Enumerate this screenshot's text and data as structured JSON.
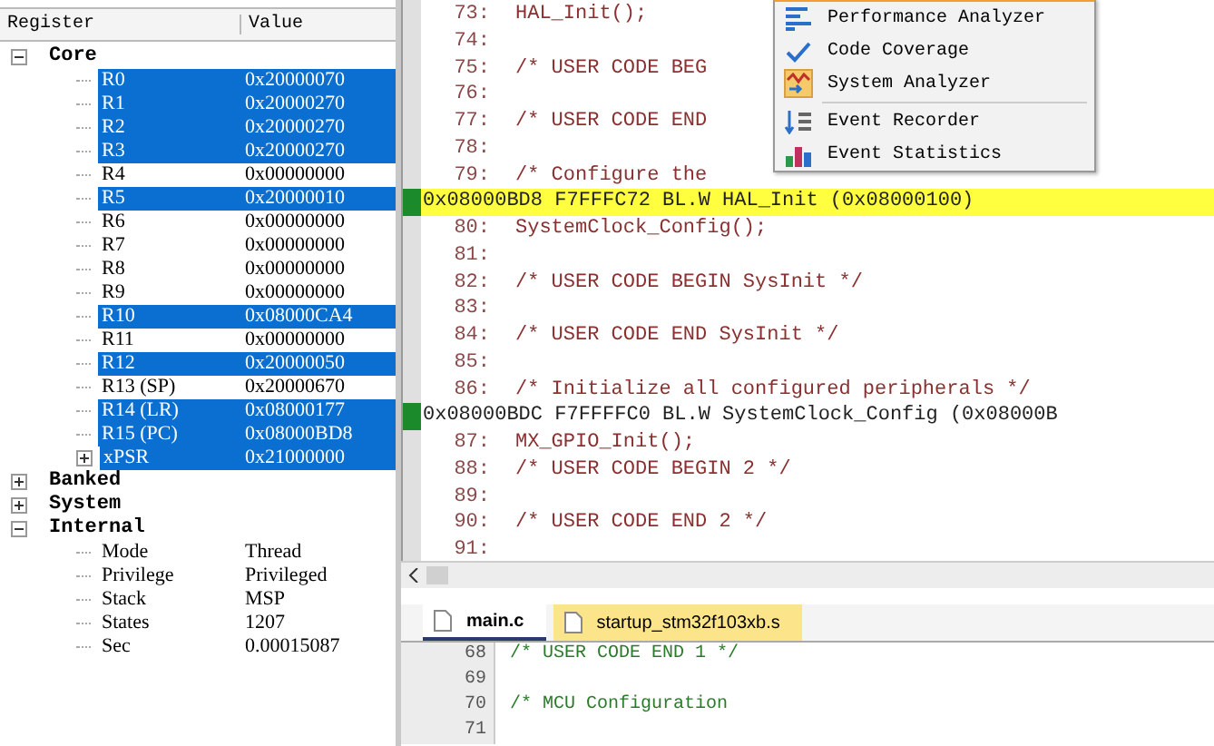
{
  "registers": {
    "columns": [
      "Register",
      "Value"
    ],
    "tree": [
      {
        "label": "Core",
        "expanded": true,
        "children": [
          {
            "label": "R0",
            "value": "0x20000070",
            "selected": true
          },
          {
            "label": "R1",
            "value": "0x20000270",
            "selected": true
          },
          {
            "label": "R2",
            "value": "0x20000270",
            "selected": true
          },
          {
            "label": "R3",
            "value": "0x20000270",
            "selected": true
          },
          {
            "label": "R4",
            "value": "0x00000000",
            "selected": false
          },
          {
            "label": "R5",
            "value": "0x20000010",
            "selected": true
          },
          {
            "label": "R6",
            "value": "0x00000000",
            "selected": false
          },
          {
            "label": "R7",
            "value": "0x00000000",
            "selected": false
          },
          {
            "label": "R8",
            "value": "0x00000000",
            "selected": false
          },
          {
            "label": "R9",
            "value": "0x00000000",
            "selected": false
          },
          {
            "label": "R10",
            "value": "0x08000CA4",
            "selected": true
          },
          {
            "label": "R11",
            "value": "0x00000000",
            "selected": false
          },
          {
            "label": "R12",
            "value": "0x20000050",
            "selected": true
          },
          {
            "label": "R13 (SP)",
            "value": "0x20000670",
            "selected": false
          },
          {
            "label": "R14 (LR)",
            "value": "0x08000177",
            "selected": true
          },
          {
            "label": "R15 (PC)",
            "value": "0x08000BD8",
            "selected": true
          },
          {
            "label": "xPSR",
            "value": "0x21000000",
            "selected": true,
            "expanded": false
          }
        ]
      },
      {
        "label": "Banked",
        "expanded": false
      },
      {
        "label": "System",
        "expanded": false
      },
      {
        "label": "Internal",
        "expanded": true,
        "children": [
          {
            "label": "Mode",
            "value": "Thread",
            "selected": false
          },
          {
            "label": "Privilege",
            "value": "Privileged",
            "selected": false
          },
          {
            "label": "Stack",
            "value": "MSP",
            "selected": false
          },
          {
            "label": "States",
            "value": "1207",
            "selected": false
          },
          {
            "label": "Sec",
            "value": "0.00015087",
            "selected": false
          }
        ]
      }
    ]
  },
  "disassembly": {
    "lines": [
      {
        "kind": "src",
        "num": "73:",
        "text": "HAL_Init();"
      },
      {
        "kind": "src",
        "num": "74:"
      },
      {
        "kind": "src",
        "num": "75:",
        "text": "/* USER CODE BEG"
      },
      {
        "kind": "src",
        "num": "76:"
      },
      {
        "kind": "src",
        "num": "77:",
        "text": "/* USER CODE END"
      },
      {
        "kind": "src",
        "num": "78:"
      },
      {
        "kind": "src",
        "num": "79:",
        "text": "/* Configure the"
      },
      {
        "kind": "asm",
        "current": true,
        "text": "0x08000BD8 F7FFFC72  BL.W      HAL_Init (0x08000100)"
      },
      {
        "kind": "src",
        "num": "80:",
        "text": "SystemClock_Config();"
      },
      {
        "kind": "src",
        "num": "81:"
      },
      {
        "kind": "src",
        "num": "82:",
        "text": "/* USER CODE BEGIN SysInit */"
      },
      {
        "kind": "src",
        "num": "83:"
      },
      {
        "kind": "src",
        "num": "84:",
        "text": "/* USER CODE END SysInit */"
      },
      {
        "kind": "src",
        "num": "85:"
      },
      {
        "kind": "src",
        "num": "86:",
        "text": "/* Initialize all configured peripherals */"
      },
      {
        "kind": "asm",
        "current": false,
        "text": "0x08000BDC F7FFFFC0  BL.W      SystemClock_Config (0x08000B"
      },
      {
        "kind": "src",
        "num": "87:",
        "text": "MX_GPIO_Init();"
      },
      {
        "kind": "src",
        "num": "88:",
        "text": "/* USER CODE BEGIN 2 */"
      },
      {
        "kind": "src",
        "num": "89:"
      },
      {
        "kind": "src",
        "num": "90:",
        "text": "/* USER CODE END 2 */"
      },
      {
        "kind": "src",
        "num": "91:"
      }
    ]
  },
  "menu": {
    "items": [
      {
        "kind": "performance",
        "label": "Performance Analyzer"
      },
      {
        "kind": "coverage",
        "label": "Code Coverage"
      },
      {
        "kind": "system",
        "label": "System Analyzer"
      },
      {
        "kind": "separator"
      },
      {
        "kind": "recorder",
        "label": "Event Recorder"
      },
      {
        "kind": "statistics",
        "label": "Event Statistics"
      }
    ]
  },
  "editor": {
    "tabs": [
      {
        "label": "main.c",
        "selected": true
      },
      {
        "label": "startup_stm32f103xb.s",
        "selected": false
      }
    ],
    "lines": [
      {
        "num": "68",
        "text": "/* USER CODE END 1 */"
      },
      {
        "num": "69"
      },
      {
        "num": "70",
        "text": "/* MCU Configuration"
      },
      {
        "num": "71"
      }
    ]
  }
}
